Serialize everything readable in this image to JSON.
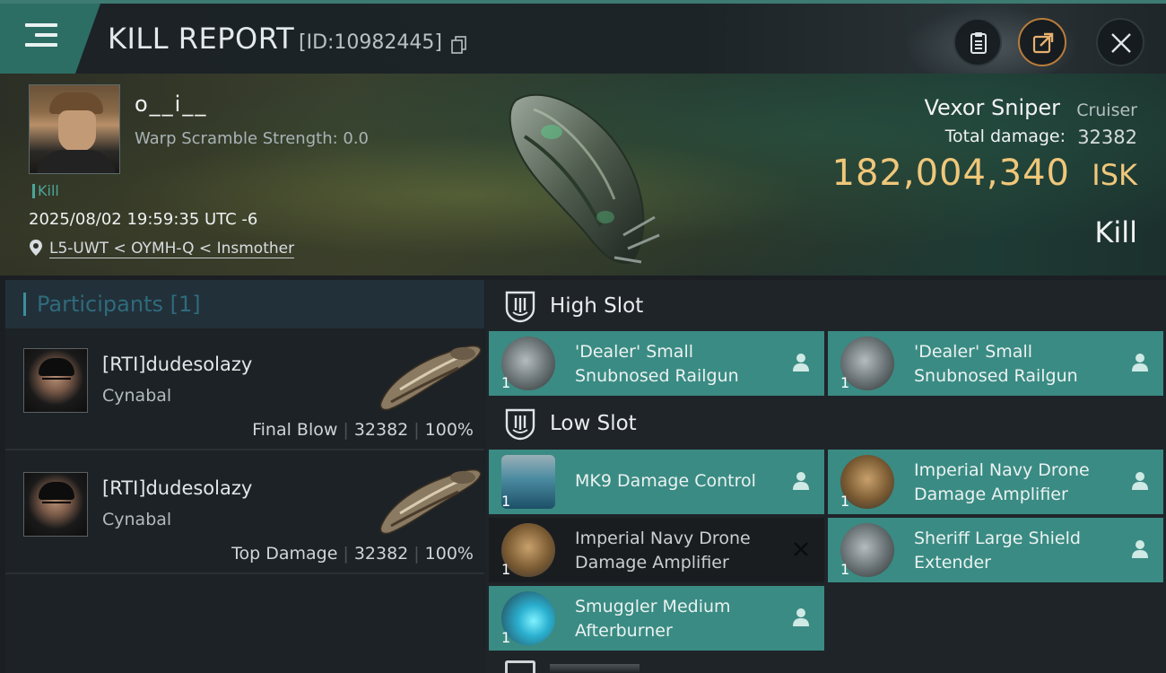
{
  "header": {
    "title": "KILL REPORT",
    "report_id": "[ID:10982445]",
    "icons": {
      "menu": "menu-icon",
      "copy": "copy-icon",
      "clipboard": "clipboard-icon",
      "share": "share-icon",
      "close": "close-icon"
    },
    "colors": {
      "accent": "#2c6d64",
      "share_ring": "#b87c3a"
    }
  },
  "victim": {
    "pilot_name": "o__i__",
    "warp_scramble": "Warp Scramble Strength: 0.0",
    "kill_tag": "Kill",
    "datetime": "2025/08/02 19:59:35 UTC -6",
    "location": "L5-UWT < OYMH-Q < Insmother",
    "ship_name": "Vexor Sniper",
    "ship_class": "Cruiser",
    "total_damage_label": "Total damage:",
    "total_damage": "32382",
    "isk_value": "182,004,340",
    "isk_unit": "ISK",
    "result": "Kill",
    "colors": {
      "isk": "#f0c77a"
    }
  },
  "participants": {
    "title": "Participants",
    "count": "[1]",
    "rows": [
      {
        "name": "[RTI]dudesolazy",
        "ship": "Cynabal",
        "role": "Final Blow",
        "damage": "32382",
        "percent": "100%"
      },
      {
        "name": "[RTI]dudesolazy",
        "ship": "Cynabal",
        "role": "Top Damage",
        "damage": "32382",
        "percent": "100%"
      }
    ]
  },
  "fittings": {
    "high_slot": {
      "label": "High Slot",
      "items": [
        {
          "name_line1": "'Dealer' Small",
          "name_line2": "Snubnosed Railgun",
          "qty": "1",
          "status": "dropped",
          "icon": "railgun-icon"
        },
        {
          "name_line1": "'Dealer' Small",
          "name_line2": "Snubnosed Railgun",
          "qty": "1",
          "status": "dropped",
          "icon": "railgun-icon"
        }
      ]
    },
    "low_slot": {
      "label": "Low Slot",
      "items": [
        {
          "name_line1": "MK9 Damage Control",
          "name_line2": "",
          "qty": "1",
          "status": "dropped",
          "icon": "damage-control-icon"
        },
        {
          "name_line1": "Imperial Navy Drone",
          "name_line2": "Damage Amplifier",
          "qty": "1",
          "status": "dropped",
          "icon": "drone-amplifier-icon"
        },
        {
          "name_line1": "Imperial Navy Drone",
          "name_line2": "Damage Amplifier",
          "qty": "1",
          "status": "destroyed",
          "icon": "drone-amplifier-icon"
        },
        {
          "name_line1": "Sheriff Large Shield",
          "name_line2": "Extender",
          "qty": "1",
          "status": "dropped",
          "icon": "shield-extender-icon"
        },
        {
          "name_line1": "Smuggler Medium",
          "name_line2": "Afterburner",
          "qty": "1",
          "status": "dropped",
          "icon": "afterburner-icon"
        }
      ]
    },
    "colors": {
      "dropped": "#3a8b83",
      "destroyed": "#1a1d20"
    }
  }
}
